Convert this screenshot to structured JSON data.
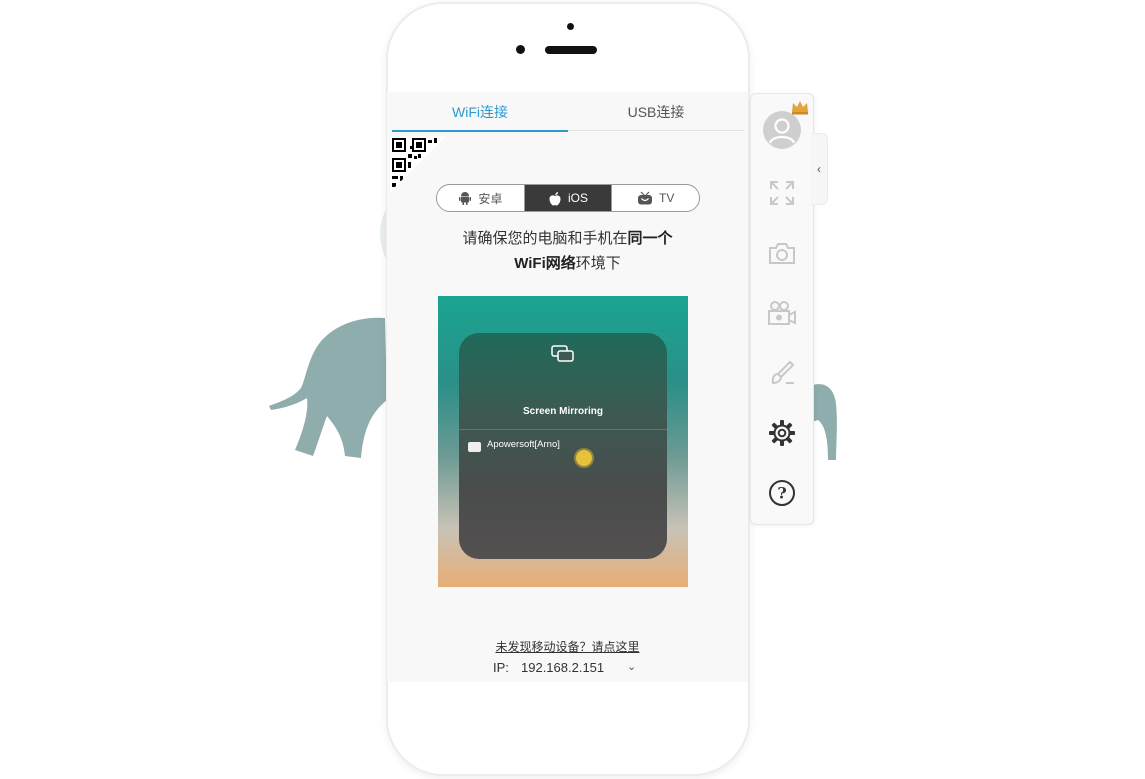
{
  "tabs": {
    "wifi_label": "WiFi连接",
    "usb_label": "USB连接"
  },
  "device_types": {
    "android": "安卓",
    "ios": "iOS",
    "tv": "TV",
    "selected": "iOS"
  },
  "instruction": {
    "line1_prefix": "请确保您的电脑和手机在",
    "line1_bold": "同一个",
    "line2_bold": "WiFi网络",
    "line2_suffix": "环境下"
  },
  "demo": {
    "title": "Screen Mirroring",
    "device": "Apowersoft[Arno]"
  },
  "footer": {
    "not_found_link": "未发现移动设备？请点这里",
    "ip_label": "IP:",
    "ip_value": "192.168.2.151"
  },
  "sidebar": {
    "items": [
      "avatar-icon",
      "fullscreen-icon",
      "screenshot-icon",
      "record-icon",
      "whiteboard-icon",
      "settings-icon",
      "help-icon"
    ]
  },
  "colors": {
    "accent": "#2a9ad0",
    "segment_active": "#3a3a3a",
    "elephant": "#8fadad"
  }
}
